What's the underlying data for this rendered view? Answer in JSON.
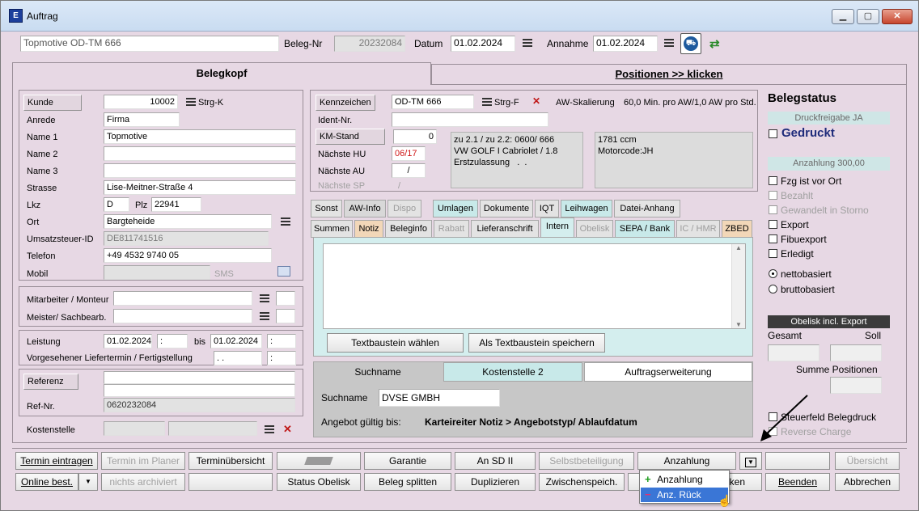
{
  "window": {
    "title": "Auftrag",
    "icon": "app-logo-icon"
  },
  "header": {
    "name": "Topmotive OD-TM 666",
    "beleg_nr_label": "Beleg-Nr",
    "beleg_nr": "20232084",
    "datum_label": "Datum",
    "datum": "01.02.2024",
    "annahme_label": "Annahme",
    "annahme": "01.02.2024"
  },
  "tabs_main": {
    "belegkopf": "Belegkopf",
    "positionen": "Positionen >> klicken"
  },
  "kunde": {
    "kunde_btn": "Kunde",
    "kunde_nr": "10002",
    "kunde_shortcut": "Strg-K",
    "anrede_label": "Anrede",
    "anrede": "Firma",
    "name1_label": "Name 1",
    "name1": "Topmotive",
    "name2_label": "Name 2",
    "name2": "",
    "name3_label": "Name 3",
    "name3": "",
    "strasse_label": "Strasse",
    "strasse": "Lise-Meitner-Straße 4",
    "lkz_label": "Lkz",
    "lkz": "D",
    "plz_label": "Plz",
    "plz": "22941",
    "ort_label": "Ort",
    "ort": "Bargteheide",
    "ust_label": "Umsatzsteuer-ID",
    "ust": "DE811741516",
    "telefon_label": "Telefon",
    "telefon": "+49 4532 9740 05",
    "mobil_label": "Mobil",
    "mobil": "",
    "sms": "SMS"
  },
  "mitarbeiter": {
    "monteur_label": "Mitarbeiter / Monteur",
    "meister_label": "Meister/ Sachbearb."
  },
  "leistung": {
    "label": "Leistung",
    "von": "01.02.2024",
    "von_zeit": ":",
    "bis_label": "bis",
    "bis": "01.02.2024",
    "bis_zeit": ":",
    "liefer_label": "Vorgesehener Liefertermin / Fertigstellung",
    "liefer": ". .",
    "liefer_zeit": ":"
  },
  "referenz": {
    "btn": "Referenz",
    "refnr_label": "Ref-Nr.",
    "refnr": "0620232084"
  },
  "kostenstelle": {
    "label": "Kostenstelle"
  },
  "fahrzeug": {
    "kennzeichen_btn": "Kennzeichen",
    "kennzeichen": "OD-TM 666",
    "shortcut": "Strg-F",
    "aw_label": "AW-Skalierung",
    "aw_value": "60,0 Min. pro AW/1,0 AW pro Std.",
    "ident_label": "Ident-Nr.",
    "ident": "",
    "km_btn": "KM-Stand",
    "km": "0",
    "hu_label": "Nächste HU",
    "hu": "06/17",
    "au_label": "Nächste AU",
    "au": "/",
    "sp_label": "Nächste SP",
    "sp": "/",
    "info1": "zu 2.1 / zu 2.2: 0600/ 666\nVW GOLF I Cabriolet / 1.8\nErstzulassung   .  .",
    "info2": "1781 ccm\nMotorcode:JH"
  },
  "subtabs1": [
    "Sonst",
    "AW-Info",
    "Dispo",
    "Umlagen",
    "Dokumente",
    "IQT",
    "Leihwagen",
    "Datei-Anhang"
  ],
  "subtabs2": [
    "Summen",
    "Notiz",
    "Beleginfo",
    "Rabatt",
    "Lieferanschrift",
    "Intern",
    "Obelisk",
    "SEPA / Bank",
    "IC / HMR",
    "ZBED"
  ],
  "intern": {
    "textbaustein_btn": "Textbaustein wählen",
    "speichern_btn": "Als Textbaustein speichern"
  },
  "suchtabs": [
    "Suchname",
    "Kostenstelle 2",
    "Auftragserweiterung"
  ],
  "suche": {
    "label": "Suchname",
    "value": "DVSE GMBH",
    "angebot_label": "Angebot gültig bis:",
    "angebot_hint": "Karteireiter Notiz > Angebotstyp/ Ablaufdatum"
  },
  "status": {
    "title": "Belegstatus",
    "druckfreigabe": "Druckfreigabe JA",
    "gedruckt": "Gedruckt",
    "anzahlung": "Anzahlung 300,00",
    "fzg": "Fzg ist vor Ort",
    "bezahlt": "Bezahlt",
    "storno": "Gewandelt in Storno",
    "export": "Export",
    "fibu": "Fibuexport",
    "erledigt": "Erledigt",
    "netto": "nettobasiert",
    "brutto": "bruttobasiert",
    "obelisk": "Obelisk incl. Export",
    "gesamt": "Gesamt",
    "soll": "Soll",
    "summe_pos": "Summe Positionen",
    "steuerfeld": "Steuerfeld Belegdruck",
    "reverse": "Reverse Charge"
  },
  "buttons_row1": {
    "termin": "Termin eintragen",
    "planer": "Termin im Planer",
    "uebersicht_termin": "Terminübersicht",
    "garantie": "Garantie",
    "ansd": "An SD II",
    "selbst": "Selbstbeteiligung",
    "anzahlung": "Anzahlung",
    "uebersicht": "Übersicht"
  },
  "buttons_row2": {
    "online": "Online best.",
    "archiv": "nichts archiviert",
    "status_obelisk": "Status Obelisk",
    "splitten": "Beleg splitten",
    "duplizieren": "Duplizieren",
    "zwischen": "Zwischenspeich.",
    "drucken_tail": "ken",
    "beenden": "Beenden",
    "abbrechen": "Abbrechen"
  },
  "dropdown": {
    "items": [
      "Anzahlung",
      "Anz. Rück"
    ]
  },
  "colors": {
    "window_bg": "#e7d8e4",
    "teal_tab": "#c8e9e9",
    "highlight": "#3a76d6",
    "gedruckt": "#1e2b7a",
    "hu_red": "#d01818"
  }
}
